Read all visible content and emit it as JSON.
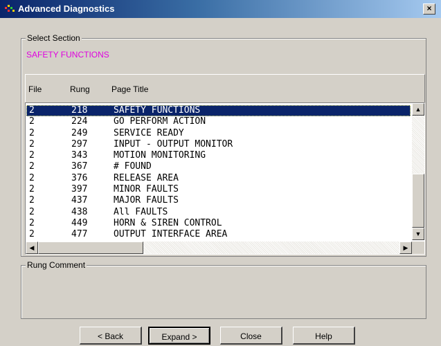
{
  "window": {
    "title": "Advanced Diagnostics",
    "close_label": "×"
  },
  "select_section": {
    "legend": "Select Section",
    "value": "SAFETY FUNCTIONS",
    "value_color": "#e000e0"
  },
  "table": {
    "columns": [
      "File",
      "Rung",
      "Page Title"
    ],
    "rows": [
      {
        "file": "2",
        "rung": "218",
        "title": "SAFETY FUNCTIONS",
        "selected": true
      },
      {
        "file": "2",
        "rung": "224",
        "title": "GO PERFORM ACTION"
      },
      {
        "file": "2",
        "rung": "249",
        "title": "SERVICE READY"
      },
      {
        "file": "2",
        "rung": "297",
        "title": "INPUT - OUTPUT MONITOR"
      },
      {
        "file": "2",
        "rung": "343",
        "title": "MOTION MONITORING"
      },
      {
        "file": "2",
        "rung": "367",
        "title": "# FOUND"
      },
      {
        "file": "2",
        "rung": "376",
        "title": "RELEASE AREA"
      },
      {
        "file": "2",
        "rung": "397",
        "title": "MINOR FAULTS"
      },
      {
        "file": "2",
        "rung": "437",
        "title": "MAJOR FAULTS"
      },
      {
        "file": "2",
        "rung": "438",
        "title": "All FAULTS"
      },
      {
        "file": "2",
        "rung": "449",
        "title": "HORN & SIREN CONTROL"
      },
      {
        "file": "2",
        "rung": "477",
        "title": "OUTPUT INTERFACE AREA"
      }
    ]
  },
  "rung_comment": {
    "legend": "Rung Comment"
  },
  "buttons": {
    "back": "< Back",
    "expand": "Expand >",
    "close": "Close",
    "help": "Help"
  },
  "colors": {
    "selection": "#0a246a",
    "face": "#d4d0c8"
  }
}
